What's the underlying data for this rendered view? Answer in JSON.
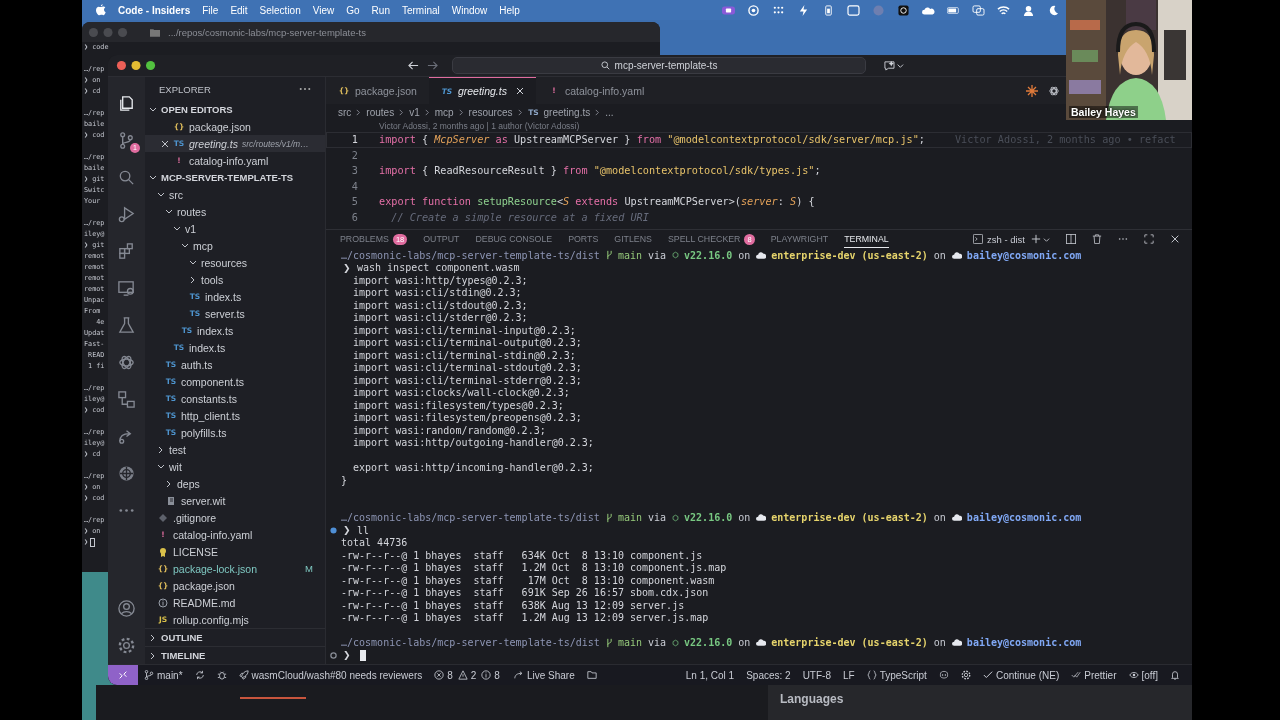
{
  "menu_bar": {
    "app_name": "Code - Insiders",
    "items": [
      "File",
      "Edit",
      "Selection",
      "View",
      "Go",
      "Run",
      "Terminal",
      "Window",
      "Help"
    ]
  },
  "background_terminal": {
    "title": ".../repos/cosmonic-labs/mcp-server-template-ts",
    "blocks": [
      [
        "❯ code"
      ],
      [
        "…/rep",
        "❯ on",
        "❯ cd"
      ],
      [
        "…/rep",
        "baile",
        "❯ cod"
      ],
      [
        "…/rep",
        "baile",
        "❯ git",
        "Switc",
        "Your"
      ],
      [
        "…/rep",
        "iley@",
        "❯ git",
        "remot",
        "remot",
        "remot",
        "remot",
        "Unpac",
        "From",
        "   4e",
        "Updat",
        "Fast-",
        " READ",
        " 1 fi"
      ],
      [
        "…/rep",
        "iley@",
        "❯ cod"
      ],
      [
        "…/rep",
        "iley@",
        "❯ cd"
      ],
      [
        "…/rep",
        "❯ on",
        "❯ cod"
      ],
      [
        "…/rep",
        "❯ on",
        "❯"
      ]
    ],
    "cursor": true
  },
  "vscode": {
    "title_bar": {
      "search": "mcp-server-template-ts"
    },
    "activity_bar": [
      {
        "kind": "files",
        "selected": true
      },
      {
        "kind": "source-control",
        "selected": false,
        "badge": "1"
      },
      {
        "kind": "search",
        "selected": false
      },
      {
        "kind": "run",
        "selected": false
      },
      {
        "kind": "extensions",
        "selected": false
      },
      {
        "kind": "remote",
        "selected": false
      },
      {
        "kind": "testing",
        "selected": false
      },
      {
        "kind": "knot",
        "selected": false
      },
      {
        "kind": "nodes",
        "selected": false
      },
      {
        "kind": "share",
        "selected": false
      },
      {
        "kind": "wheel",
        "selected": false
      },
      {
        "kind": "more",
        "selected": false
      }
    ],
    "activity_bottom": [
      {
        "kind": "account"
      },
      {
        "kind": "settings"
      }
    ],
    "sidebar": {
      "title": "EXPLORER",
      "open_editors": {
        "title": "OPEN EDITORS",
        "expanded": true,
        "items": [
          {
            "kind": "json",
            "icon": "{}",
            "name": "package.json",
            "selected": false,
            "preview": false
          },
          {
            "kind": "ts",
            "icon": "TS",
            "name": "greeting.ts",
            "detail": "src/routes/v1/m…",
            "selected": true,
            "preview": true
          },
          {
            "kind": "yaml",
            "icon": "!",
            "name": "catalog-info.yaml",
            "selected": false,
            "preview": false
          }
        ]
      },
      "project": {
        "title": "MCP-SERVER-TEMPLATE-TS",
        "expanded": true,
        "tree": [
          {
            "kind": "folder",
            "name": "src",
            "expanded": true,
            "children": [
              {
                "kind": "folder",
                "name": "routes",
                "expanded": true,
                "children": [
                  {
                    "kind": "folder",
                    "name": "v1",
                    "expanded": true,
                    "children": [
                      {
                        "kind": "folder",
                        "name": "mcp",
                        "expanded": true,
                        "children": [
                          {
                            "kind": "folder",
                            "name": "resources",
                            "expanded": true
                          },
                          {
                            "kind": "folder",
                            "name": "tools",
                            "expanded": false
                          },
                          {
                            "kind": "ts",
                            "icon": "TS",
                            "name": "index.ts"
                          },
                          {
                            "kind": "ts",
                            "icon": "TS",
                            "name": "server.ts"
                          }
                        ]
                      },
                      {
                        "kind": "ts",
                        "icon": "TS",
                        "name": "index.ts"
                      }
                    ]
                  },
                  {
                    "kind": "ts",
                    "icon": "TS",
                    "name": "index.ts"
                  }
                ]
              },
              {
                "kind": "ts",
                "icon": "TS",
                "name": "auth.ts"
              },
              {
                "kind": "ts",
                "icon": "TS",
                "name": "component.ts"
              },
              {
                "kind": "ts",
                "icon": "TS",
                "name": "constants.ts"
              },
              {
                "kind": "ts",
                "icon": "TS",
                "name": "http_client.ts"
              },
              {
                "kind": "ts",
                "icon": "TS",
                "name": "polyfills.ts"
              }
            ]
          },
          {
            "kind": "folder",
            "name": "test",
            "expanded": false
          },
          {
            "kind": "folder",
            "name": "wit",
            "expanded": true,
            "children": [
              {
                "kind": "folder",
                "name": "deps",
                "expanded": false
              },
              {
                "kind": "wit",
                "name": "server.wit"
              }
            ]
          },
          {
            "kind": "git",
            "name": ".gitignore"
          },
          {
            "kind": "yaml",
            "icon": "!",
            "name": "catalog-info.yaml"
          },
          {
            "kind": "license",
            "name": "LICENSE"
          },
          {
            "kind": "json",
            "icon": "{}",
            "name": "package-lock.json",
            "status": "M"
          },
          {
            "kind": "json",
            "icon": "{}",
            "name": "package.json"
          },
          {
            "kind": "readme",
            "name": "README.md"
          },
          {
            "kind": "js",
            "icon": "JS",
            "name": "rollup.config.mjs"
          }
        ]
      },
      "sections": [
        {
          "title": "OUTLINE",
          "expanded": false
        },
        {
          "title": "TIMELINE",
          "expanded": false
        }
      ]
    },
    "editor": {
      "tabs": [
        {
          "kind": "json",
          "icon": "{}",
          "label": "package.json",
          "selected": false
        },
        {
          "kind": "ts",
          "icon": "TS",
          "label": "greeting.ts",
          "selected": true
        },
        {
          "kind": "yaml",
          "icon": "!",
          "label": "catalog-info.yaml",
          "selected": false
        }
      ],
      "breadcrumbs": [
        {
          "text": "src"
        },
        {
          "text": "routes"
        },
        {
          "text": "v1"
        },
        {
          "text": "mcp"
        },
        {
          "text": "resources"
        },
        {
          "icon": "TS",
          "text": "greeting.ts"
        },
        {
          "text": "..."
        }
      ],
      "blame": "Victor Adossi, 2 months ago | 1 author (Victor Adossi)",
      "lines": [
        {
          "number": "1",
          "tokens": [
            {
              "kind": "kw",
              "text": "import"
            },
            {
              "kind": "plain",
              "text": " { "
            },
            {
              "kind": "type",
              "text": "McpServer"
            },
            {
              "kind": "kw",
              "text": " as "
            },
            {
              "kind": "plain",
              "text": "UpstreamMCPServer } "
            },
            {
              "kind": "kw",
              "text": "from"
            },
            {
              "kind": "str",
              "text": " \"@modelcontextprotocol/sdk/server/mcp.js\""
            },
            {
              "kind": "plain",
              "text": ";"
            }
          ],
          "inline_blame": "Victor Adossi, 2 months ago • refact"
        },
        {
          "number": "2"
        },
        {
          "number": "3",
          "tokens": [
            {
              "kind": "kw",
              "text": "import"
            },
            {
              "kind": "plain",
              "text": " { ReadResourceResult } "
            },
            {
              "kind": "kw",
              "text": "from"
            },
            {
              "kind": "str",
              "text": " \"@modelcontextprotocol/sdk/types.js\""
            },
            {
              "kind": "plain",
              "text": ";"
            }
          ]
        },
        {
          "number": "4"
        },
        {
          "number": "5",
          "tokens": [
            {
              "kind": "kw",
              "text": "export function"
            },
            {
              "kind": "fn",
              "text": " setupResource"
            },
            {
              "kind": "plain",
              "text": "<"
            },
            {
              "kind": "type",
              "text": "S"
            },
            {
              "kind": "kw",
              "text": " extends "
            },
            {
              "kind": "plain",
              "text": "UpstreamMCPServer>("
            },
            {
              "kind": "param",
              "text": "server"
            },
            {
              "kind": "plain",
              "text": ": "
            },
            {
              "kind": "type",
              "text": "S"
            },
            {
              "kind": "plain",
              "text": ") {"
            }
          ]
        },
        {
          "number": "6",
          "tokens": [
            {
              "kind": "comment",
              "text": "  // Create a simple resource at a fixed URI"
            }
          ]
        }
      ]
    },
    "panel": {
      "tabs": [
        {
          "label": "PROBLEMS",
          "badge": "18",
          "selected": false
        },
        {
          "label": "OUTPUT",
          "selected": false
        },
        {
          "label": "DEBUG CONSOLE",
          "selected": false
        },
        {
          "label": "PORTS",
          "selected": false
        },
        {
          "label": "GITLENS",
          "selected": false
        },
        {
          "label": "SPELL CHECKER",
          "badge": "8",
          "selected": false
        },
        {
          "label": "PLAYWRIGHT",
          "selected": false
        },
        {
          "label": "TERMINAL",
          "selected": true
        }
      ],
      "terminal_name": "zsh - dist",
      "terminal": [
        {
          "kind": "prompt",
          "segments": [
            {
              "kind": "path",
              "text": "…/cosmonic-labs/mcp-server-template-ts/dist"
            },
            {
              "kind": "branch",
              "text": "main"
            },
            {
              "kind": "plain",
              "text": "via"
            },
            {
              "kind": "node",
              "text": "v22.16.0"
            },
            {
              "kind": "plain",
              "text": "on"
            },
            {
              "kind": "context",
              "text": "enterprise-dev (us-east-2)"
            },
            {
              "kind": "plain",
              "text": "on"
            },
            {
              "kind": "account",
              "text": "bailey@cosmonic.com"
            }
          ]
        },
        {
          "kind": "command",
          "symbol": "❯",
          "text": "wash inspect component.wasm"
        },
        {
          "kind": "output",
          "text": "  import wasi:http/types@0.2.3;"
        },
        {
          "kind": "output",
          "text": "  import wasi:cli/stdin@0.2.3;"
        },
        {
          "kind": "output",
          "text": "  import wasi:cli/stdout@0.2.3;"
        },
        {
          "kind": "output",
          "text": "  import wasi:cli/stderr@0.2.3;"
        },
        {
          "kind": "output",
          "text": "  import wasi:cli/terminal-input@0.2.3;"
        },
        {
          "kind": "output",
          "text": "  import wasi:cli/terminal-output@0.2.3;"
        },
        {
          "kind": "output",
          "text": "  import wasi:cli/terminal-stdin@0.2.3;"
        },
        {
          "kind": "output",
          "text": "  import wasi:cli/terminal-stdout@0.2.3;"
        },
        {
          "kind": "output",
          "text": "  import wasi:cli/terminal-stderr@0.2.3;"
        },
        {
          "kind": "output",
          "text": "  import wasi:clocks/wall-clock@0.2.3;"
        },
        {
          "kind": "output",
          "text": "  import wasi:filesystem/types@0.2.3;"
        },
        {
          "kind": "output",
          "text": "  import wasi:filesystem/preopens@0.2.3;"
        },
        {
          "kind": "output",
          "text": "  import wasi:random/random@0.2.3;"
        },
        {
          "kind": "output",
          "text": "  import wasi:http/outgoing-handler@0.2.3;"
        },
        {
          "kind": "blank"
        },
        {
          "kind": "output",
          "text": "  export wasi:http/incoming-handler@0.2.3;"
        },
        {
          "kind": "output",
          "text": "}"
        },
        {
          "kind": "blank"
        },
        {
          "kind": "blank"
        },
        {
          "kind": "prompt",
          "segments": [
            {
              "kind": "path",
              "text": "…/cosmonic-labs/mcp-server-template-ts/dist"
            },
            {
              "kind": "branch",
              "text": "main"
            },
            {
              "kind": "plain",
              "text": "via"
            },
            {
              "kind": "node",
              "text": "v22.16.0"
            },
            {
              "kind": "plain",
              "text": "on"
            },
            {
              "kind": "context",
              "text": "enterprise-dev (us-east-2)"
            },
            {
              "kind": "plain",
              "text": "on"
            },
            {
              "kind": "account",
              "text": "bailey@cosmonic.com"
            }
          ]
        },
        {
          "kind": "command",
          "symbol": "❯",
          "text": "ll",
          "decorated": true,
          "completed": true
        },
        {
          "kind": "output",
          "text": "total 44736"
        },
        {
          "kind": "output",
          "text": "-rw-r--r--@ 1 bhayes  staff   634K Oct  8 13:10 component.js"
        },
        {
          "kind": "output",
          "text": "-rw-r--r--@ 1 bhayes  staff   1.2M Oct  8 13:10 component.js.map"
        },
        {
          "kind": "output",
          "text": "-rw-r--r--@ 1 bhayes  staff    17M Oct  8 13:10 component.wasm"
        },
        {
          "kind": "output",
          "text": "-rw-r--r--@ 1 bhayes  staff   691K Sep 26 16:57 sbom.cdx.json"
        },
        {
          "kind": "output",
          "text": "-rw-r--r--@ 1 bhayes  staff   638K Aug 13 12:09 server.js"
        },
        {
          "kind": "output",
          "text": "-rw-r--r--@ 1 bhayes  staff   1.2M Aug 13 12:09 server.js.map"
        },
        {
          "kind": "blank"
        },
        {
          "kind": "prompt",
          "segments": [
            {
              "kind": "path",
              "text": "…/cosmonic-labs/mcp-server-template-ts/dist"
            },
            {
              "kind": "branch",
              "text": "main"
            },
            {
              "kind": "plain",
              "text": "via"
            },
            {
              "kind": "node",
              "text": "v22.16.0"
            },
            {
              "kind": "plain",
              "text": "on"
            },
            {
              "kind": "context",
              "text": "enterprise-dev (us-east-2)"
            },
            {
              "kind": "plain",
              "text": "on"
            },
            {
              "kind": "account",
              "text": "bailey@cosmonic.com"
            }
          ]
        },
        {
          "kind": "command",
          "symbol": "❯",
          "decorated": true,
          "completed": false,
          "cursor": true
        }
      ]
    },
    "status_bar": {
      "left": [
        {
          "kind": "remote"
        },
        {
          "kind": "branch",
          "text": "main*"
        },
        {
          "kind": "sync"
        },
        {
          "kind": "bug"
        },
        {
          "kind": "rocket",
          "text": "wasmCloud/wash#80 needs reviewers"
        },
        {
          "kind": "problems",
          "counts": [
            {
              "kind": "error",
              "text": "8"
            },
            {
              "kind": "warning",
              "text": "2"
            },
            {
              "kind": "info",
              "text": "8"
            }
          ]
        },
        {
          "kind": "share",
          "text": "Live Share"
        },
        {
          "kind": "folder"
        }
      ],
      "right": [
        {
          "kind": "text",
          "text": "Ln 1, Col 1"
        },
        {
          "kind": "text",
          "text": "Spaces: 2"
        },
        {
          "kind": "text",
          "text": "UTF-8"
        },
        {
          "kind": "text",
          "text": "LF"
        },
        {
          "kind": "braces",
          "text": "TypeScript"
        },
        {
          "kind": "copilot"
        },
        {
          "kind": "gear"
        },
        {
          "kind": "check",
          "text": "Continue (NE)"
        },
        {
          "kind": "double-check",
          "text": "Prettier"
        },
        {
          "kind": "eye",
          "text": "[off]"
        },
        {
          "kind": "bell"
        }
      ]
    }
  },
  "browser_behind": {
    "heading": "Languages"
  },
  "webcam": {
    "name": "Bailey Hayes"
  }
}
